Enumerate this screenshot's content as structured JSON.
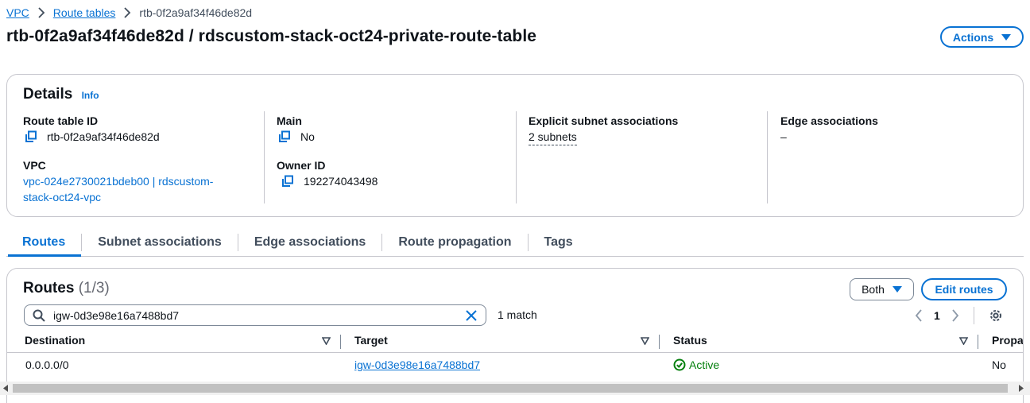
{
  "breadcrumb": {
    "items": [
      "VPC",
      "Route tables"
    ],
    "current": "rtb-0f2a9af34f46de82d"
  },
  "page": {
    "title": "rtb-0f2a9af34f46de82d / rdscustom-stack-oct24-private-route-table",
    "actions_label": "Actions"
  },
  "details": {
    "title": "Details",
    "info_label": "Info",
    "route_table_id_label": "Route table ID",
    "route_table_id": "rtb-0f2a9af34f46de82d",
    "vpc_label": "VPC",
    "vpc_line1": "vpc-024e2730021bdeb00 | rdscustom-",
    "vpc_line2": "stack-oct24-vpc",
    "main_label": "Main",
    "main_value": "No",
    "owner_label": "Owner ID",
    "owner_value": "192274043498",
    "subnet_assoc_label": "Explicit subnet associations",
    "subnet_assoc_value": "2 subnets",
    "edge_assoc_label": "Edge associations",
    "edge_assoc_value": "–"
  },
  "tabs": [
    {
      "label": "Routes",
      "active": true
    },
    {
      "label": "Subnet associations",
      "active": false
    },
    {
      "label": "Edge associations",
      "active": false
    },
    {
      "label": "Route propagation",
      "active": false
    },
    {
      "label": "Tags",
      "active": false
    }
  ],
  "routes": {
    "title": "Routes",
    "count": "(1/3)",
    "filter_label": "Both",
    "edit_label": "Edit routes",
    "search_value": "igw-0d3e98e16a7488bd7",
    "match_text": "1 match",
    "page_number": "1",
    "columns": [
      "Destination",
      "Target",
      "Status",
      "Propaga"
    ],
    "rows": [
      {
        "destination": "0.0.0.0/0",
        "target": "igw-0d3e98e16a7488bd7",
        "status": "Active",
        "propagated": "No"
      }
    ]
  },
  "colors": {
    "link": "#0972d3",
    "success": "#037f0c",
    "border": "#c6c6cd"
  },
  "icons": [
    "chevron-right-icon",
    "caret-down-icon",
    "copy-icon",
    "search-icon",
    "clear-icon",
    "chevron-left-icon",
    "settings-icon",
    "sort-icon",
    "status-success-icon"
  ]
}
